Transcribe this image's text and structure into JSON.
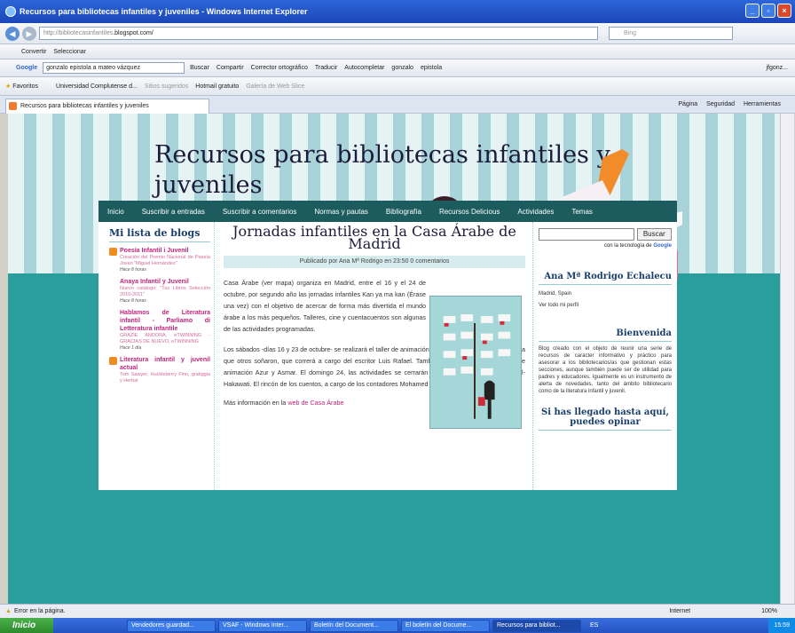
{
  "window": {
    "title": "Recursos para bibliotecas infantiles y juveniles - Windows Internet Explorer"
  },
  "address": {
    "url_prefix": "http://bibliotecasinfantiles",
    "url_domain": ".blogspot.com/",
    "search_placeholder": "Bing"
  },
  "convert_bar": {
    "convert": "Convertir",
    "select": "Seleccionar"
  },
  "google_bar": {
    "logo": "Google",
    "query": "gonzalo epistola a mateo vázquez",
    "items": [
      "Buscar",
      "Compartir",
      "Corrector ortográfico",
      "Traducir",
      "Autocompletar",
      "gonzalo",
      "epistola",
      "jfgonz..."
    ]
  },
  "favorites_bar": {
    "favorites": "Favoritos",
    "items": [
      "Universidad Complutense d...",
      "Sitios sugeridos",
      "Hotmail gratuito",
      "Galería de Web Slice"
    ]
  },
  "tab": {
    "label": "Recursos para bibliotecas infantiles y juveniles"
  },
  "commandbar": {
    "items": [
      "Página",
      "Seguridad",
      "Herramientas"
    ]
  },
  "blog": {
    "title": "Recursos para bibliotecas infantiles y juveniles",
    "nav": [
      "Inicio",
      "Suscribir a entradas",
      "Suscribir a comentarios",
      "Normas y pautas",
      "Bibliografía",
      "Recursos Delicious",
      "Actividades",
      "Temas"
    ],
    "sidebar_title": "Mi lista de blogs",
    "blogs": [
      {
        "name": "Poesía Infantil i Juvenil",
        "desc": "Creación del Premio Nacional de Poesía Joven \"Miguel Hernández\"",
        "time": "Hace 8 horas"
      },
      {
        "name": "Anaya Infantil y Juvenil",
        "desc": "Nuevo catálogo: \"Tus Libros Selección 2010-2011\"",
        "time": "Hace 8 horas"
      },
      {
        "name": "Hablamos de Literatura infantil - Parliamo di Letteratura infantile",
        "desc": "GRAZIE ANDORA, eTWINNING - GRACIAS DE NUEVO, eTWINNING",
        "time": "Hace 1 día"
      },
      {
        "name": "Literatura infantil y juvenil actual",
        "desc": "Tom Sawyer, Huckleberry Finn, gratiggia y Herbal",
        "time": ""
      }
    ],
    "post": {
      "title": "Jornadas infantiles en la Casa Árabe de Madrid",
      "meta": "Publicado por Ana Mª Rodrigo  en 23:50  0 comentarios",
      "p1": "Casa Árabe (ver mapa) organiza en Madrid, entre el 16 y el 24 de octubre, por segundo año las jornadas infantiles Kan ya ma kan (Érase una vez) con el objetivo de acercar de forma más divertida el mundo árabe a los más pequeños. Talleres, cine y cuentacuentos son algunas de las actividades programadas.",
      "p2": "Los sábados -días 16 y 23 de octubre- se realizará el taller de animación a la lectura Leer, leer, vivir la vida que otros soñaron, que correrá a cargo del escritor Luis Rafael. También se proyectará la película de animación Azur y Asmar. El domingo 24, las actividades se cerrarán con el cuentacuentos Roken al-Hakawati. El rincón de los cuentos, a cargo de los contadores Mohamed Hammu y Boni Ofogo.",
      "p3_prefix": "Más información en la ",
      "p3_link": "web de Casa Árabe"
    },
    "search_button": "Buscar",
    "powered": "con la tecnología de",
    "powered_brand": "Google",
    "author": "Ana Mª Rodrigo Echalecu",
    "location": "Madrid, Spain",
    "profile_link": "Ver todo mi perfil",
    "welcome_title": "Bienvenida",
    "welcome_text": "Blog creado con el objeto de reunir una serie de recursos de carácter informativo y práctico para asesorar a los bibliotecarios/as que gestionan estas secciones, aunque también puede ser de utilidad para padres y educadores. Igualmente es un instrumento de alerta de novedades, tanto del ámbito bibliotecario como de la literatura infantil y juvenil.",
    "more_title": "Si has llegado hasta aquí, puedes opinar"
  },
  "statusbar": {
    "text": "Error en la página.",
    "zone": "Internet",
    "zoom": "100%"
  },
  "taskbar": {
    "start": "Inicio",
    "items": [
      "Vendedores guardad...",
      "VSAF - Windows Inter...",
      "Boletín del Document...",
      "El boletín del Docume...",
      "Recursos para bibliot..."
    ],
    "lang": "ES",
    "time": "15:59"
  }
}
